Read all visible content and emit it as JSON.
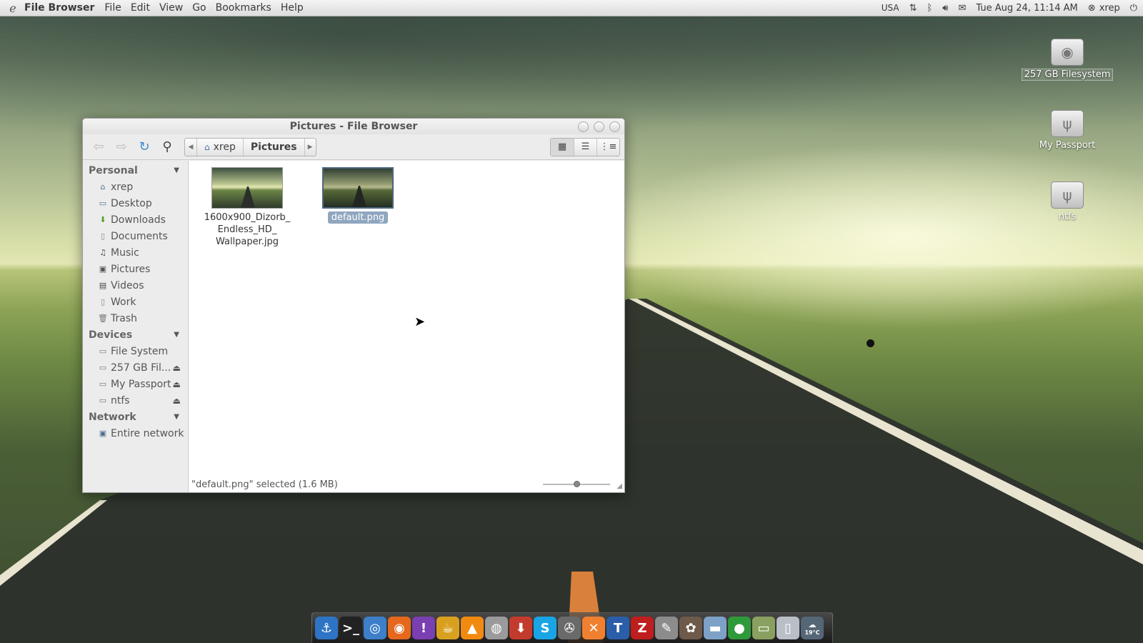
{
  "top_panel": {
    "app_name": "File Browser",
    "menus": [
      "File",
      "Edit",
      "View",
      "Go",
      "Bookmarks",
      "Help"
    ],
    "keyboard_layout": "USA",
    "datetime": "Tue Aug 24, 11:14 AM",
    "user": "xrep"
  },
  "desktop_icons": [
    {
      "label": "257 GB Filesystem",
      "icon": "hard-disk-icon"
    },
    {
      "label": "My Passport",
      "icon": "usb-drive-icon"
    },
    {
      "label": "ntfs",
      "icon": "usb-drive-icon"
    }
  ],
  "window": {
    "title": "Pictures - File Browser",
    "path": [
      {
        "label": "xrep",
        "icon": "home-folder-icon"
      },
      {
        "label": "Pictures"
      }
    ],
    "sidebar": {
      "sections": [
        {
          "header": "Personal",
          "items": [
            {
              "label": "xrep",
              "icon": "home-folder-icon"
            },
            {
              "label": "Desktop",
              "icon": "desktop-icon"
            },
            {
              "label": "Downloads",
              "icon": "downloads-icon"
            },
            {
              "label": "Documents",
              "icon": "documents-icon"
            },
            {
              "label": "Music",
              "icon": "music-icon"
            },
            {
              "label": "Pictures",
              "icon": "pictures-icon"
            },
            {
              "label": "Videos",
              "icon": "videos-icon"
            },
            {
              "label": "Work",
              "icon": "folder-icon"
            },
            {
              "label": "Trash",
              "icon": "trash-icon"
            }
          ]
        },
        {
          "header": "Devices",
          "items": [
            {
              "label": "File System",
              "icon": "filesystem-icon"
            },
            {
              "label": "257 GB Fil...",
              "icon": "hard-disk-icon",
              "eject": true
            },
            {
              "label": "My Passport",
              "icon": "drive-icon",
              "eject": true
            },
            {
              "label": "ntfs",
              "icon": "drive-icon",
              "eject": true
            }
          ]
        },
        {
          "header": "Network",
          "items": [
            {
              "label": "Entire network",
              "icon": "network-icon"
            }
          ]
        }
      ]
    },
    "files": [
      {
        "name": "1600x900_Dizorb_\nEndless_HD_\nWallpaper.jpg",
        "selected": false
      },
      {
        "name": "default.png",
        "selected": true
      }
    ],
    "status": "\"default.png\" selected (1.6 MB)",
    "zoom_level": 0.5
  },
  "dock": [
    {
      "icon": "anchor-icon",
      "color": "#2d74c4"
    },
    {
      "icon": "terminal-icon",
      "color": "#222222"
    },
    {
      "icon": "browser-globe-icon",
      "color": "#3d7fc9"
    },
    {
      "icon": "firefox-icon",
      "color": "#e5681d"
    },
    {
      "icon": "chat-bubble-icon",
      "color": "#7a3fb0"
    },
    {
      "icon": "teapot-icon",
      "color": "#d9a020"
    },
    {
      "icon": "vlc-cone-icon",
      "color": "#f28a12"
    },
    {
      "icon": "speaker-icon",
      "color": "#9a9a9a"
    },
    {
      "icon": "download-manager-icon",
      "color": "#c33b2c"
    },
    {
      "icon": "skype-icon",
      "color": "#19a4e6"
    },
    {
      "icon": "media-reel-icon",
      "color": "#6a6a6a"
    },
    {
      "icon": "crossover-icon",
      "color": "#f08030"
    },
    {
      "icon": "text-editor-icon",
      "color": "#2b5ea8"
    },
    {
      "icon": "filezilla-icon",
      "color": "#bf1e1e"
    },
    {
      "icon": "notepad-icon",
      "color": "#8c8c8c"
    },
    {
      "icon": "gimp-icon",
      "color": "#6d5a4a"
    },
    {
      "icon": "folder-icon",
      "color": "#7ea1c8"
    },
    {
      "icon": "green-orb-icon",
      "color": "#2f9a3a"
    },
    {
      "icon": "image-viewer-icon",
      "color": "#8aa060"
    },
    {
      "icon": "trash-can-icon",
      "color": "#b9bfc6"
    },
    {
      "icon": "weather-icon",
      "color": "#556677",
      "text": "19°C"
    }
  ]
}
